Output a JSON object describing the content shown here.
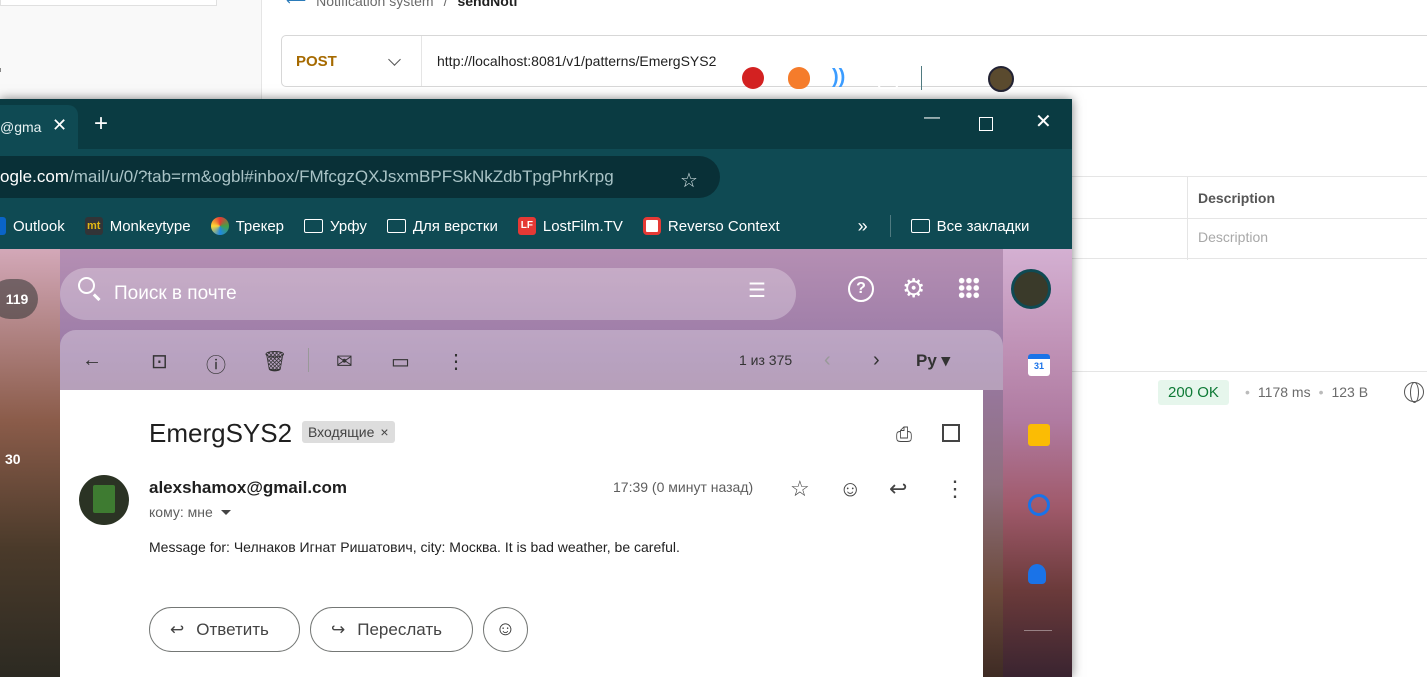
{
  "api_client": {
    "breadcrumb_parent": "Notification system",
    "breadcrumb_sep": "/",
    "breadcrumb_current": "sendNoti",
    "method": "POST",
    "url": "http://localhost:8081/v1/patterns/EmergSYS2",
    "params_header": "Description",
    "params_placeholder": "Description",
    "response_status": "200 OK",
    "response_time": "1178 ms",
    "response_size": "123 B",
    "dot": "•"
  },
  "browser": {
    "tab_title": "@gma",
    "tab_close": "✕",
    "new_tab": "+",
    "url_domain": "ogle.com",
    "url_path": "/mail/u/0/?tab=rm&ogbl#inbox/FMfcgzQXJsxmBPFSkNkZdbTpgPhrKrpg",
    "window_controls": {
      "minimize": "—",
      "close": "✕"
    },
    "bookmarks": [
      {
        "label": "Outlook",
        "icon": "outlook-icon"
      },
      {
        "label": "Monkeytype",
        "icon": "monkeytype-icon"
      },
      {
        "label": "Трекер",
        "icon": "tracker-icon"
      },
      {
        "label": "Урфу",
        "icon": "folder-icon"
      },
      {
        "label": "Для верстки",
        "icon": "folder-icon"
      },
      {
        "label": "LostFilm.TV",
        "icon": "lostfilm-icon"
      },
      {
        "label": "Reverso Context",
        "icon": "reverso-icon"
      }
    ],
    "bookmarks_overflow": "»",
    "all_bookmarks": "Все закладки"
  },
  "gmail": {
    "search_placeholder": "Поиск в почте",
    "left_counts": [
      "119",
      "30"
    ],
    "pager": "1 из 375",
    "input_lang": "Ру",
    "subject": "EmergSYS2",
    "label": "Входящие",
    "label_remove": "×",
    "sender": "alexshamox@gmail.com",
    "to": "кому: мне",
    "time": "17:39 (0 минут назад)",
    "message": "Message for: Челнаков Игнат Ришатович, city: Москва. It is bad weather, be careful.",
    "reply_label": "Ответить",
    "forward_label": "Переслать",
    "calendar_day": "31"
  },
  "colors": {
    "accent_green": "#0e7a36",
    "method_color": "#a66a00",
    "browser_frame": "#0f4a53"
  }
}
